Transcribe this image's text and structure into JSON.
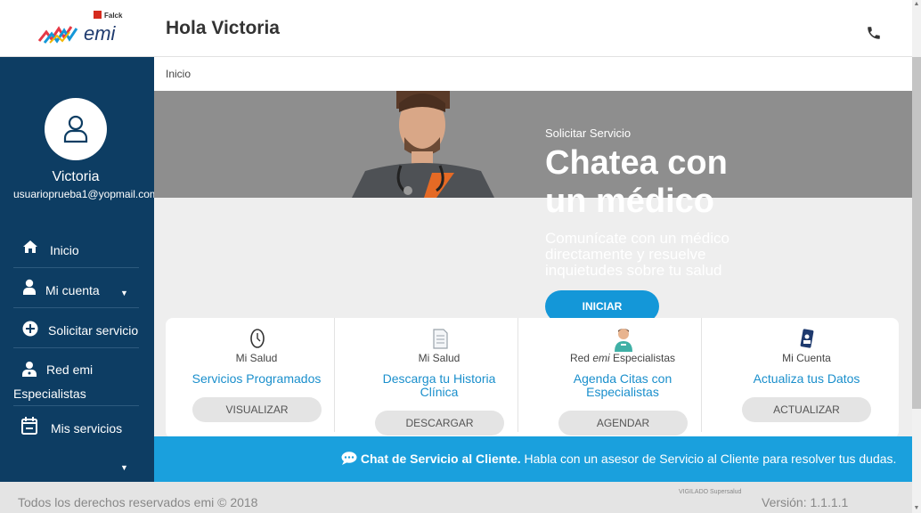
{
  "header": {
    "brand_small": "Falck",
    "brand": "emi",
    "greeting": "Hola Victoria"
  },
  "sidebar": {
    "user_name": "Victoria",
    "user_email": "usuarioprueba1@yopmail.com",
    "items": [
      {
        "label": "Inicio",
        "icon": "home-icon"
      },
      {
        "label": "Mi cuenta",
        "icon": "user-icon"
      },
      {
        "label": "Solicitar servicio",
        "icon": "plus-circle-icon"
      },
      {
        "label": "Red emi",
        "label2": "Especialistas",
        "icon": "doctor-icon"
      },
      {
        "label": "Mis servicios",
        "icon": "calendar-icon"
      }
    ]
  },
  "breadcrumb": "Inicio",
  "hero": {
    "subtitle": "Solicitar Servicio",
    "title": "Chatea con un médico",
    "description": "Comunícate con un médico directamente y resuelve inquietudes sobre tu salud",
    "button": "INICIAR"
  },
  "cards": [
    {
      "category": "Mi Salud",
      "link": "Servicios Programados",
      "button": "VISUALIZAR",
      "icon": "clock-icon"
    },
    {
      "category": "Mi Salud",
      "link": "Descarga tu Historia Clínica",
      "button": "DESCARGAR",
      "icon": "document-icon"
    },
    {
      "category_pre": "Red ",
      "category_em": "emi",
      "category_post": " Especialistas",
      "link": "Agenda Citas con Especialistas",
      "button": "AGENDAR",
      "icon": "nurse-icon"
    },
    {
      "category": "Mi Cuenta",
      "link": "Actualiza tus Datos",
      "button": "ACTUALIZAR",
      "icon": "id-card-icon"
    }
  ],
  "chat": {
    "bold": "Chat de Servicio al Cliente.",
    "text": " Habla con un asesor de Servicio al Cliente para resolver tus dudas."
  },
  "footer": {
    "rights": "Todos los derechos reservados emi © 2018",
    "vigilado": "VIGILADO Supersalud",
    "version": "Versión: 1.1.1.1"
  },
  "colors": {
    "sidebar": "#0d3d63",
    "accent": "#1aa0dd",
    "link": "#1a8fcc"
  }
}
